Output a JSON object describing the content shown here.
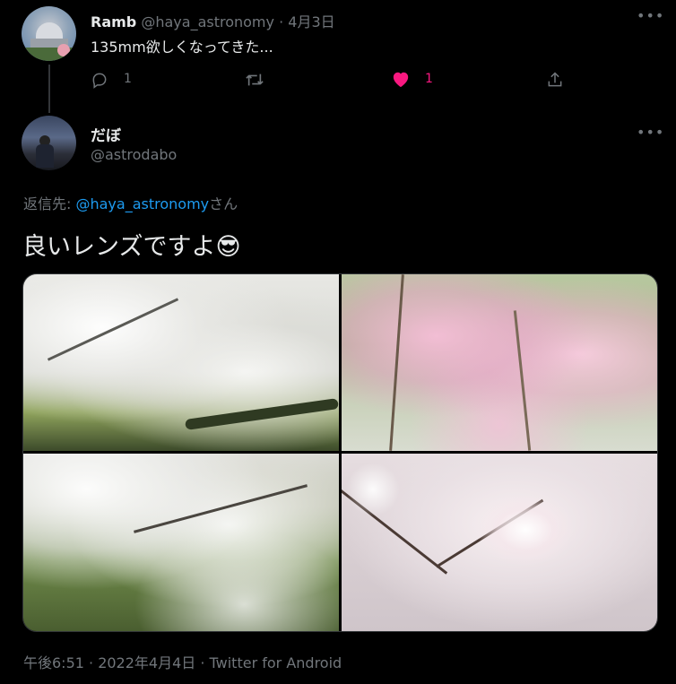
{
  "parent_tweet": {
    "name": "Ramb",
    "handle": "@haya_astronomy",
    "separator": "·",
    "date": "4月3日",
    "text": "135mm欲しくなってきた...",
    "reply_count": "1",
    "like_count": "1",
    "colors": {
      "like": "#f91880"
    }
  },
  "tweet": {
    "name": "だぼ",
    "handle": "@astrodabo",
    "reply_to_prefix": "返信先: ",
    "reply_to_handle": "@haya_astronomy",
    "reply_to_suffix": "さん",
    "text": "良いレンズですよ😎",
    "timestamp": "午後6:51 · 2022年4月4日 · Twitter for Android",
    "colors": {
      "link": "#1d9bf0"
    }
  },
  "photos": [
    {
      "name": "white-cherry-blossom-river"
    },
    {
      "name": "pink-weeping-cherry"
    },
    {
      "name": "cherry-blossom-grass"
    },
    {
      "name": "cherry-branch-soft"
    }
  ]
}
